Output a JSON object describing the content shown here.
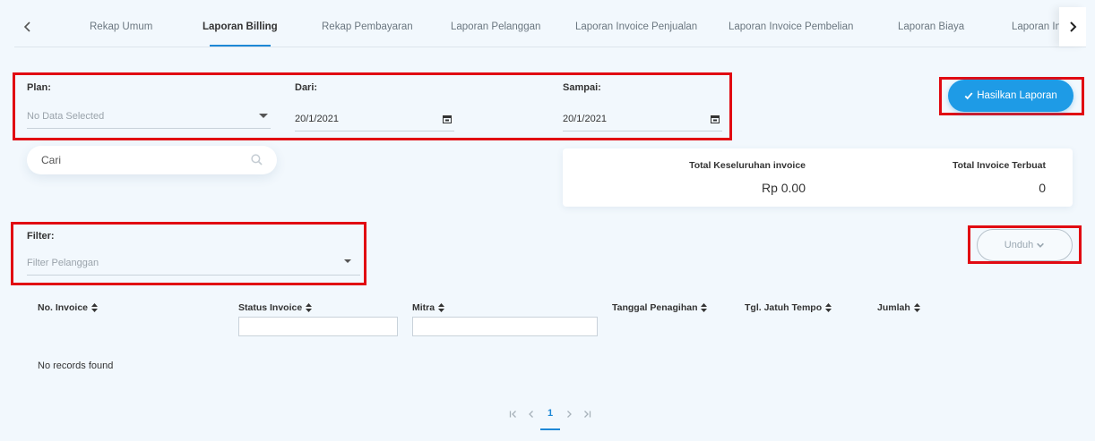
{
  "tabs": [
    {
      "label": "Rekap Umum",
      "active": false
    },
    {
      "label": "Laporan Billing",
      "active": true
    },
    {
      "label": "Rekap Pembayaran",
      "active": false
    },
    {
      "label": "Laporan Pelanggan",
      "active": false
    },
    {
      "label": "Laporan Invoice Penjualan",
      "active": false
    },
    {
      "label": "Laporan Invoice Pembelian",
      "active": false
    },
    {
      "label": "Laporan Biaya",
      "active": false
    },
    {
      "label": "Laporan Invoice",
      "active": false
    }
  ],
  "form": {
    "plan_label": "Plan:",
    "plan_placeholder": "No Data Selected",
    "dari_label": "Dari:",
    "dari_value": "20/1/2021",
    "sampai_label": "Sampai:",
    "sampai_value": "20/1/2021"
  },
  "generate_button": {
    "label": "Hasilkan Laporan",
    "icon": "check-icon"
  },
  "search": {
    "placeholder": "Cari"
  },
  "summary": {
    "total_label": "Total Keseluruhan invoice",
    "total_value": "Rp 0.00",
    "count_label": "Total Invoice Terbuat",
    "count_value": "0"
  },
  "filter": {
    "label": "Filter:",
    "placeholder": "Filter Pelanggan"
  },
  "download_button": {
    "label": "Unduh",
    "icon": "chevron-down-icon"
  },
  "table": {
    "columns": [
      "No. Invoice",
      "Status Invoice",
      "Mitra",
      "Tanggal Penagihan",
      "Tgl. Jatuh Tempo",
      "Jumlah"
    ],
    "empty_message": "No records found"
  },
  "pagination": {
    "current_page": "1"
  },
  "colors": {
    "accent": "#1e9be6",
    "annotation": "#e10a12",
    "background": "#f2f8fd"
  }
}
